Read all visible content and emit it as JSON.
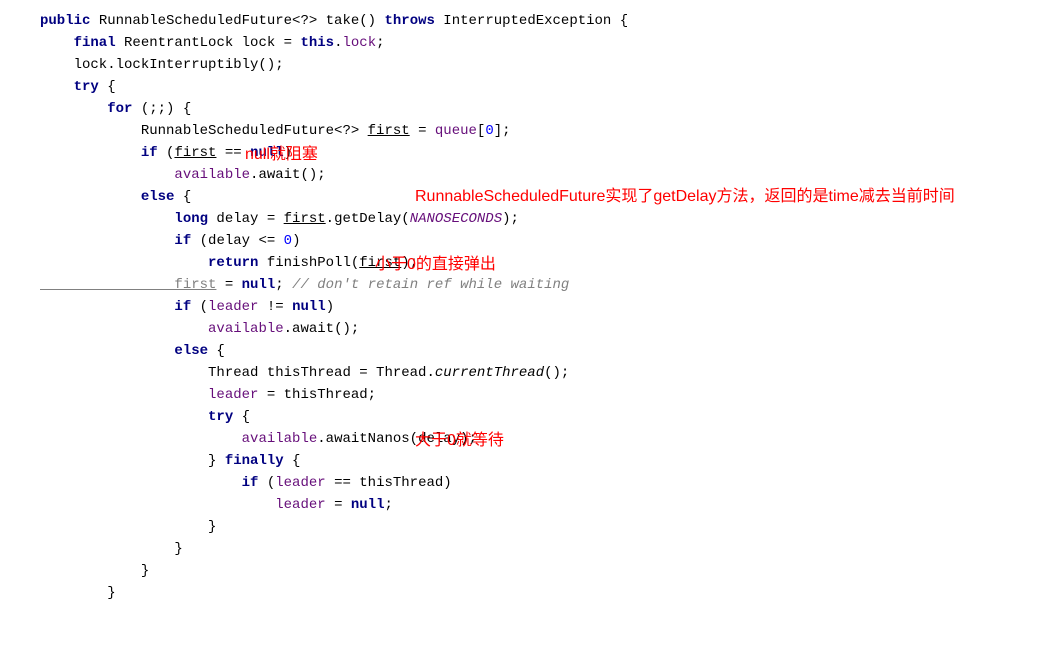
{
  "code": {
    "l1_public": "public",
    "l1_type": " RunnableScheduledFuture<?> take() ",
    "l1_throws": "throws",
    "l1_exc": " InterruptedException {",
    "l2_final": "    final",
    "l2_rest": " ReentrantLock lock = ",
    "l2_this": "this",
    "l2_dot": ".",
    "l2_field": "lock",
    "l2_semi": ";",
    "l3": "    lock.lockInterruptibly();",
    "l4_try": "    try",
    "l4_brace": " {",
    "l5_for": "        for",
    "l5_rest": " (;;) {",
    "l6_a": "            RunnableScheduledFuture<?> ",
    "l6_first": "first",
    "l6_b": " = ",
    "l6_queue": "queue",
    "l6_c": "[",
    "l6_num": "0",
    "l6_d": "];",
    "l7_if": "            if",
    "l7_a": " (",
    "l7_first": "first",
    "l7_b": " == ",
    "l7_null": "null",
    "l7_c": ")",
    "l8_a": "                ",
    "l8_avail": "available",
    "l8_b": ".await();",
    "l9_else": "            else",
    "l9_brace": " {",
    "l10_long": "                long",
    "l10_a": " delay = ",
    "l10_first": "first",
    "l10_b": ".getDelay(",
    "l10_nano": "NANOSECONDS",
    "l10_c": ");",
    "l11_if": "                if",
    "l11_a": " (delay <= ",
    "l11_zero": "0",
    "l11_b": ")",
    "l12_return": "                    return",
    "l12_a": " finishPoll(",
    "l12_first": "first",
    "l12_b": ");",
    "l13_first": "                first",
    "l13_eq": " = ",
    "l13_null": "null",
    "l13_semi": "; ",
    "l13_comment": "// don't retain ref while waiting",
    "l14_if": "                if",
    "l14_a": " (",
    "l14_leader": "leader",
    "l14_b": " != ",
    "l14_null": "null",
    "l14_c": ")",
    "l15_a": "                    ",
    "l15_avail": "available",
    "l15_b": ".await();",
    "l16_else": "                else",
    "l16_brace": " {",
    "l17_a": "                    Thread thisThread = Thread.",
    "l17_m": "currentThread",
    "l17_b": "();",
    "l18_a": "                    ",
    "l18_leader": "leader",
    "l18_b": " = thisThread;",
    "l19_try": "                    try",
    "l19_brace": " {",
    "l20_a": "                        ",
    "l20_avail": "available",
    "l20_b": ".awaitNanos(delay);",
    "l21_a": "                    } ",
    "l21_finally": "finally",
    "l21_brace": " {",
    "l22_if": "                        if",
    "l22_a": " (",
    "l22_leader": "leader",
    "l22_b": " == thisThread)",
    "l23_a": "                            ",
    "l23_leader": "leader",
    "l23_b": " = ",
    "l23_null": "null",
    "l23_semi": ";",
    "l24": "                    }",
    "l25": "                }",
    "l26": "            }",
    "l27": "        }"
  },
  "annotations": {
    "a1": "null就阻塞",
    "a2": "RunnableScheduledFuture实现了getDelay方法，返回的是time减去当前时间",
    "a3": "小于0的直接弹出",
    "a4": "大于0就等待"
  }
}
